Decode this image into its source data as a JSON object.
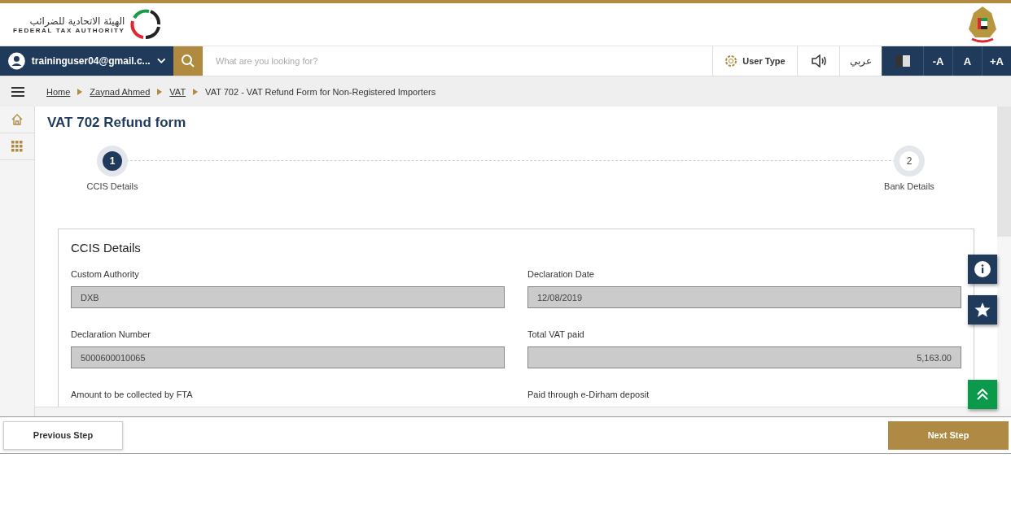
{
  "header": {
    "logo_arabic": "الهيئة الاتحادية للضرائب",
    "logo_english": "FEDERAL TAX AUTHORITY"
  },
  "nav": {
    "user_email": "traininguser04@gmail.c...",
    "search": {
      "placeholder": "What are you looking for?"
    },
    "user_type": "User Type",
    "language": "عربي",
    "font_buttons": [
      "-A",
      "A",
      "+A"
    ]
  },
  "breadcrumb": [
    {
      "label": "Home",
      "current": false
    },
    {
      "label": "Zaynad Ahmed",
      "current": false
    },
    {
      "label": "VAT",
      "current": false
    },
    {
      "label": "VAT 702 - VAT Refund Form for Non-Registered Importers",
      "current": true
    }
  ],
  "page_title": "VAT 702 Refund form",
  "steps": [
    {
      "number": "1",
      "label": "CCIS Details",
      "selected": true
    },
    {
      "number": "2",
      "label": "Bank Details",
      "selected": false
    }
  ],
  "card": {
    "title": "CCIS Details",
    "fields": [
      {
        "label": "Custom Authority",
        "value": "DXB",
        "kind": "text"
      },
      {
        "label": "Declaration Date",
        "value": "12/08/2019",
        "kind": "text"
      },
      {
        "label": "Declaration Number",
        "value": "5000600010065",
        "kind": "text"
      },
      {
        "label": "Total VAT paid",
        "value": "5,163.00",
        "kind": "amount"
      },
      {
        "label": "Amount to be collected by FTA"
      },
      {
        "label": "Paid through e-Dirham deposit"
      }
    ]
  },
  "footer": {
    "previous": "Previous Step",
    "next": "Next Step"
  }
}
